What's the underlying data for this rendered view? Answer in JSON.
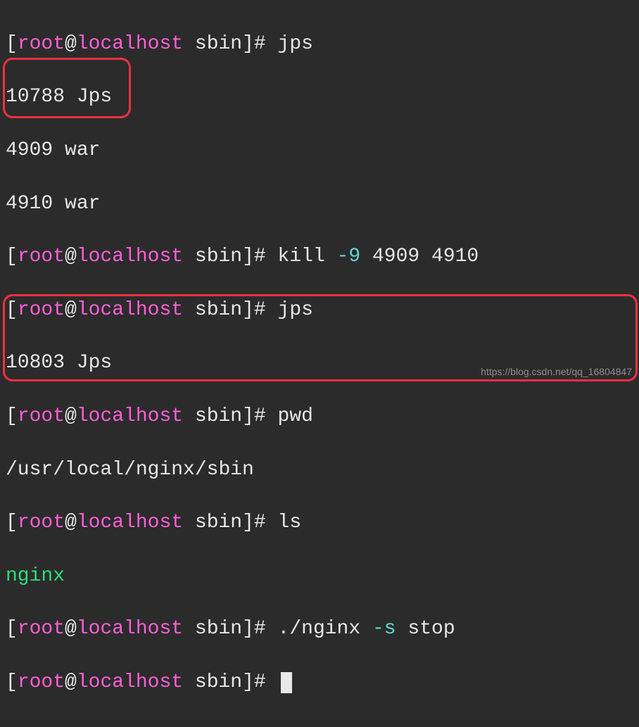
{
  "prompt": {
    "user": "root",
    "host": "localhost",
    "cwd": "sbin"
  },
  "lines": {
    "l1_cmd": "jps",
    "l2": "10788 Jps",
    "l3": "4909 war",
    "l4": "4910 war",
    "l5_cmd": "kill",
    "l5_flag": "-9",
    "l5_args": "4909 4910",
    "l6_cmd": "jps",
    "l7": "10803 Jps",
    "l8_cmd": "pwd",
    "l9": "/usr/local/nginx/sbin",
    "l10_cmd": "ls",
    "l11": "nginx",
    "l12_cmd": "./nginx",
    "l12_flag": "-s",
    "l12_arg": "stop"
  },
  "watermark": "https://blog.csdn.net/qq_16804847"
}
